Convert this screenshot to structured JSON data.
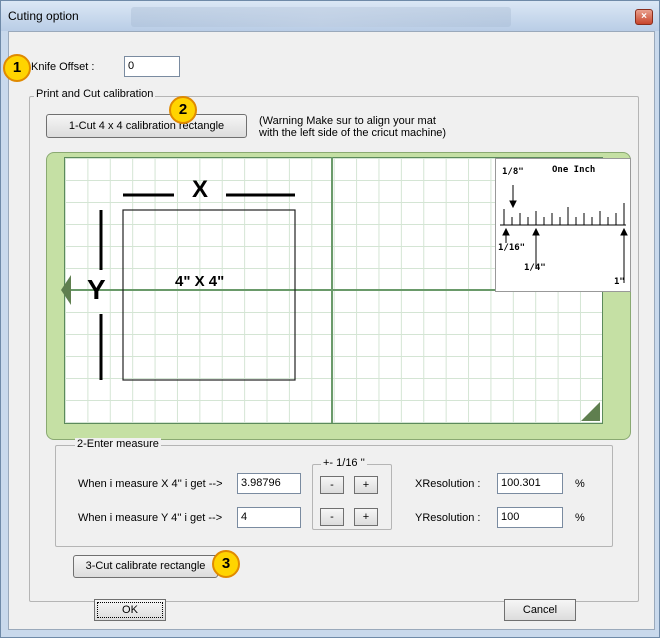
{
  "window": {
    "title": "Cuting option",
    "close_glyph": "×"
  },
  "knife_offset": {
    "label": "Knife Offset :",
    "value": "0"
  },
  "print_cut": {
    "legend": "Print and Cut calibration",
    "cut_button": "1-Cut 4 x 4 calibration rectangle",
    "warning_line1": "(Warning Make sur to align your mat",
    "warning_line2": "with the left side of the cricut machine)"
  },
  "diagram": {
    "x_label": "X",
    "y_label": "Y",
    "size_label": "4\" X 4\"",
    "ruler": {
      "eighth": "1/8\"",
      "one_inch_top": "One Inch",
      "sixteenth": "1/16\"",
      "quarter": "1/4\"",
      "one_inch_bottom": "1\""
    }
  },
  "measure": {
    "legend": "2-Enter measure",
    "x_label": "When i measure X 4'' i get -->",
    "x_value": "3.98796",
    "y_label": "When i measure Y 4'' i get -->",
    "y_value": "4",
    "step_legend": "+- 1/16 ''",
    "minus": "-",
    "plus": "+",
    "xres_label": "XResolution :",
    "xres_value": "100.301",
    "yres_label": "YResolution :",
    "yres_value": "100",
    "percent": "%"
  },
  "cut_calibrate_button": "3-Cut calibrate rectangle",
  "ok_button": "OK",
  "cancel_button": "Cancel",
  "badges": [
    "1",
    "2",
    "3"
  ],
  "colors": {
    "badge_fill": "#ffd400",
    "mat_green": "#c5e0a4",
    "frame_blue": "#c9d9ec"
  }
}
